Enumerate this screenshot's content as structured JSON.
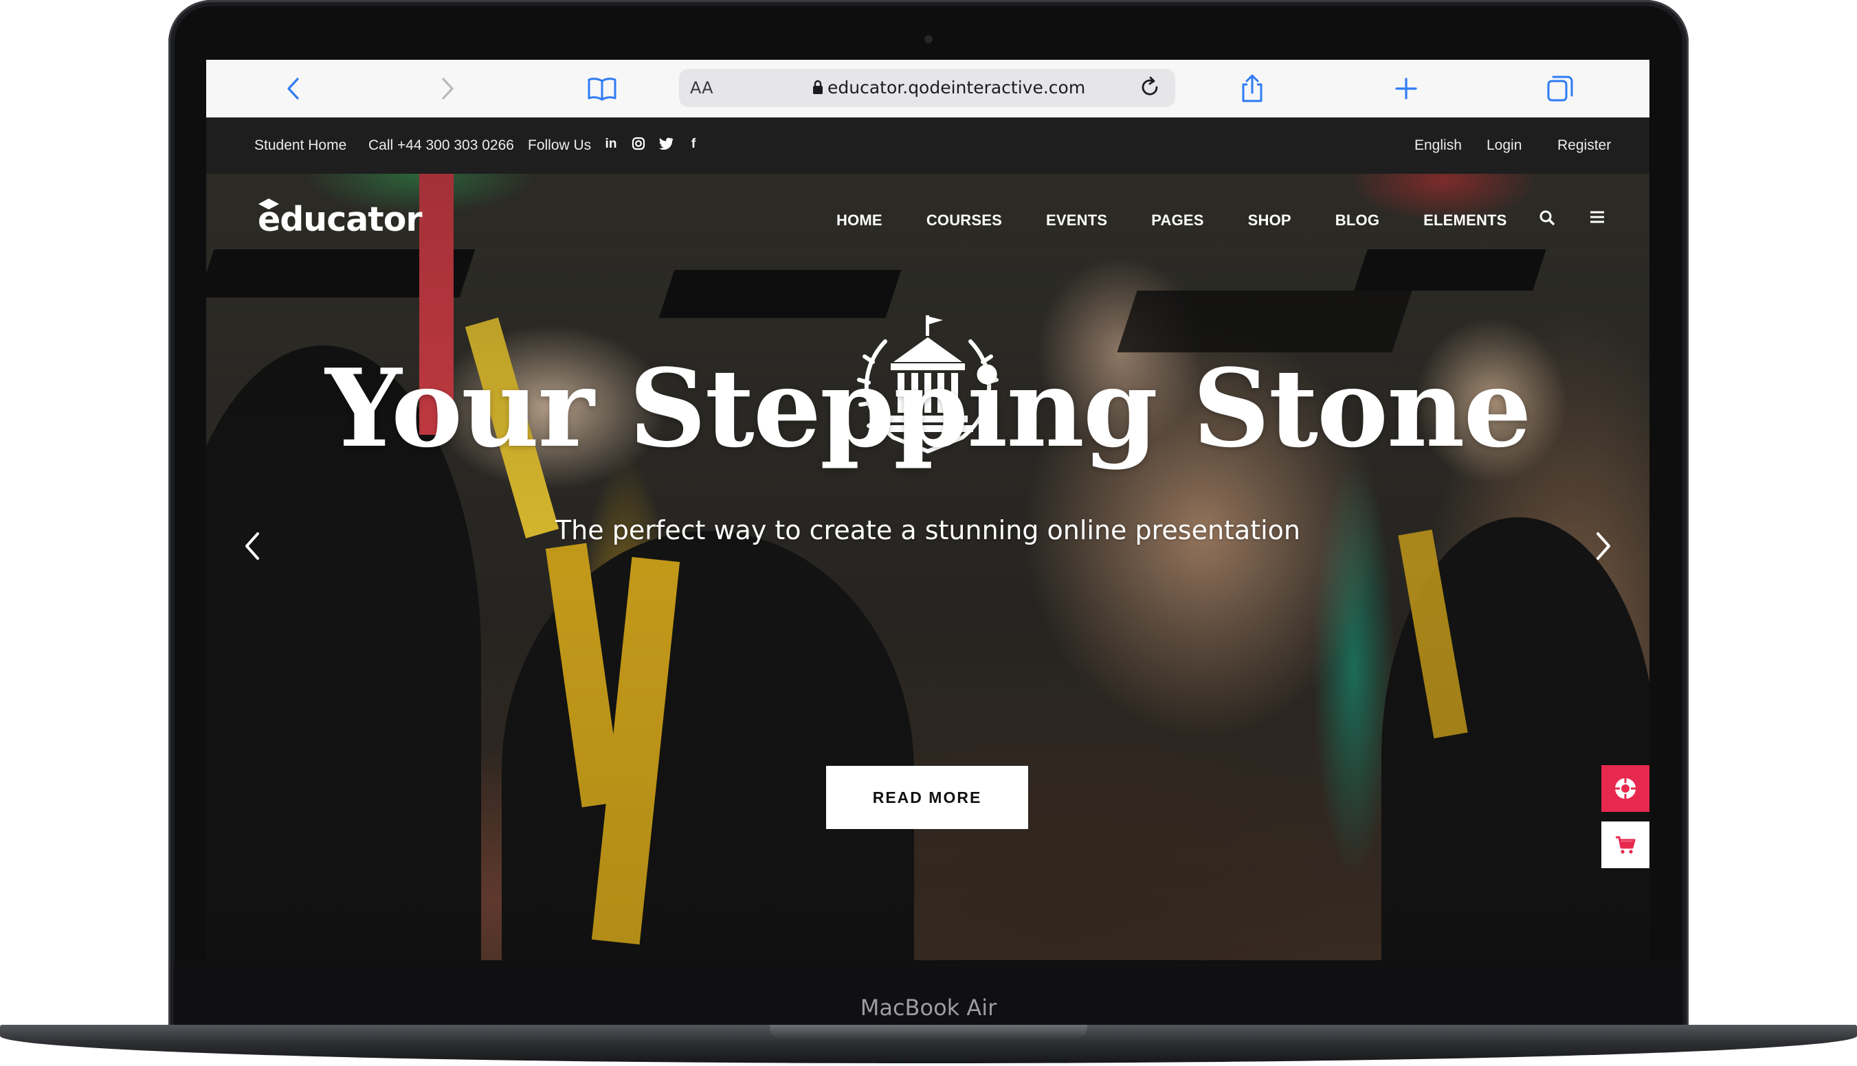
{
  "device": {
    "model_label": "MacBook Air"
  },
  "browser": {
    "reader_label": "AA",
    "url": "educator.qodeinteractive.com",
    "icons": [
      "chevron-left-icon",
      "chevron-right-icon",
      "bookmarks-icon",
      "lock-icon",
      "reload-icon",
      "share-icon",
      "plus-icon",
      "tabs-icon"
    ]
  },
  "topbar": {
    "student_home": "Student Home",
    "phone": "Call +44 300 303 0266",
    "follow_us": "Follow Us",
    "social_icons": [
      "linkedin-icon",
      "instagram-icon",
      "twitter-icon",
      "facebook-icon"
    ],
    "language": "English",
    "login": "Login",
    "register": "Register"
  },
  "site": {
    "logo": "educator",
    "nav": [
      "HOME",
      "COURSES",
      "EVENTS",
      "PAGES",
      "SHOP",
      "BLOG",
      "ELEMENTS"
    ],
    "nav_icons": [
      "search-icon",
      "menu-icon"
    ]
  },
  "hero": {
    "title": "Your Stepping Stone",
    "subtitle": "The perfect way to create a stunning online presentation",
    "button": "READ MORE",
    "crest_icon": "university-crest-icon",
    "side_buttons": [
      "lifebuoy-icon",
      "cart-icon"
    ],
    "accent_color": "#e8294f"
  }
}
